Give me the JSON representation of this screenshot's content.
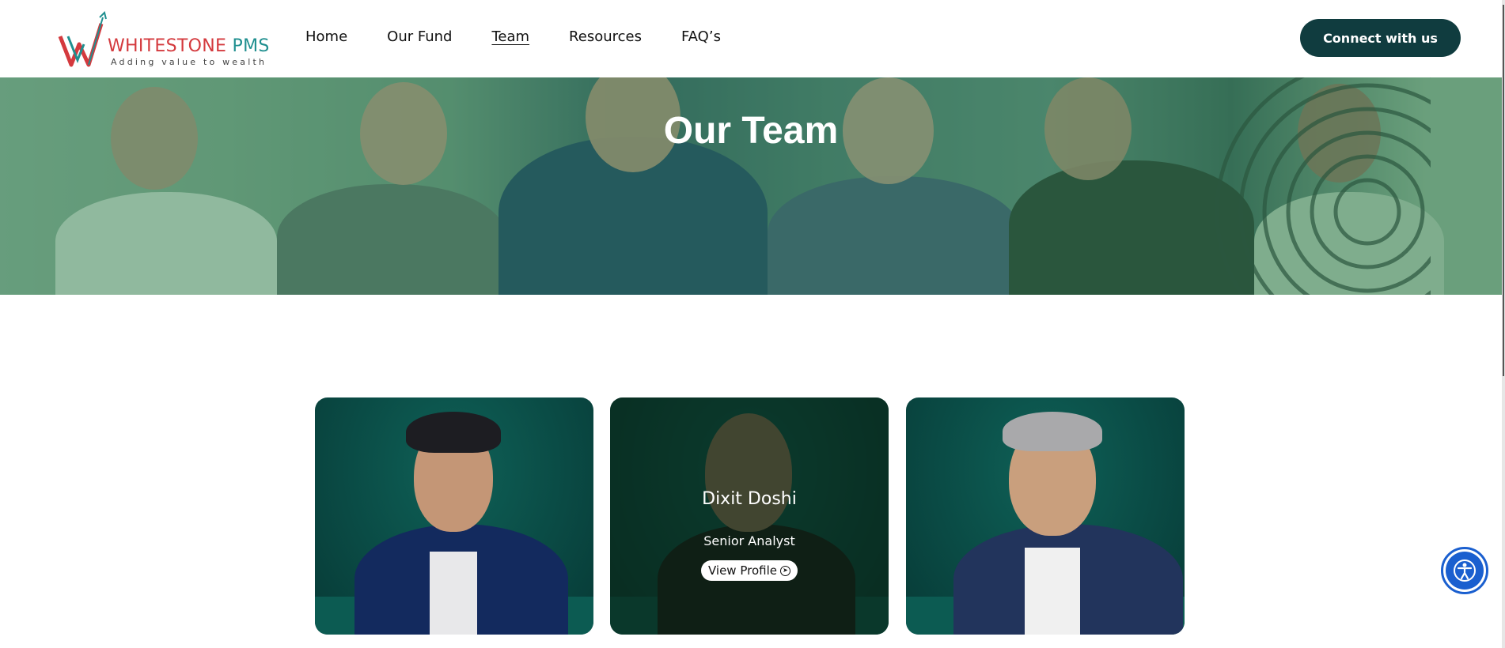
{
  "brand": {
    "name_part1": "WHITESTONE",
    "name_part2": " PMS",
    "tagline": "Adding value to wealth",
    "colors": {
      "red": "#d43a3e",
      "teal": "#1f8f8f",
      "dark": "#103c3f"
    }
  },
  "nav": {
    "items": [
      {
        "label": "Home",
        "active": false
      },
      {
        "label": "Our Fund",
        "active": false
      },
      {
        "label": "Team",
        "active": true
      },
      {
        "label": "Resources",
        "active": false
      },
      {
        "label": "FAQ’s",
        "active": false
      }
    ],
    "cta_label": "Connect with us"
  },
  "hero": {
    "title": "Our Team"
  },
  "team_cards": [
    {
      "name": "",
      "role": "",
      "hovered": false
    },
    {
      "name": "Dixit Doshi",
      "role": "Senior Analyst",
      "button_label": "View Profile",
      "hovered": true
    },
    {
      "name": "",
      "role": "",
      "hovered": false
    }
  ],
  "icons": {
    "accessibility": "accessibility-icon",
    "view_profile_arrow": "arrow-circle-right-icon"
  }
}
